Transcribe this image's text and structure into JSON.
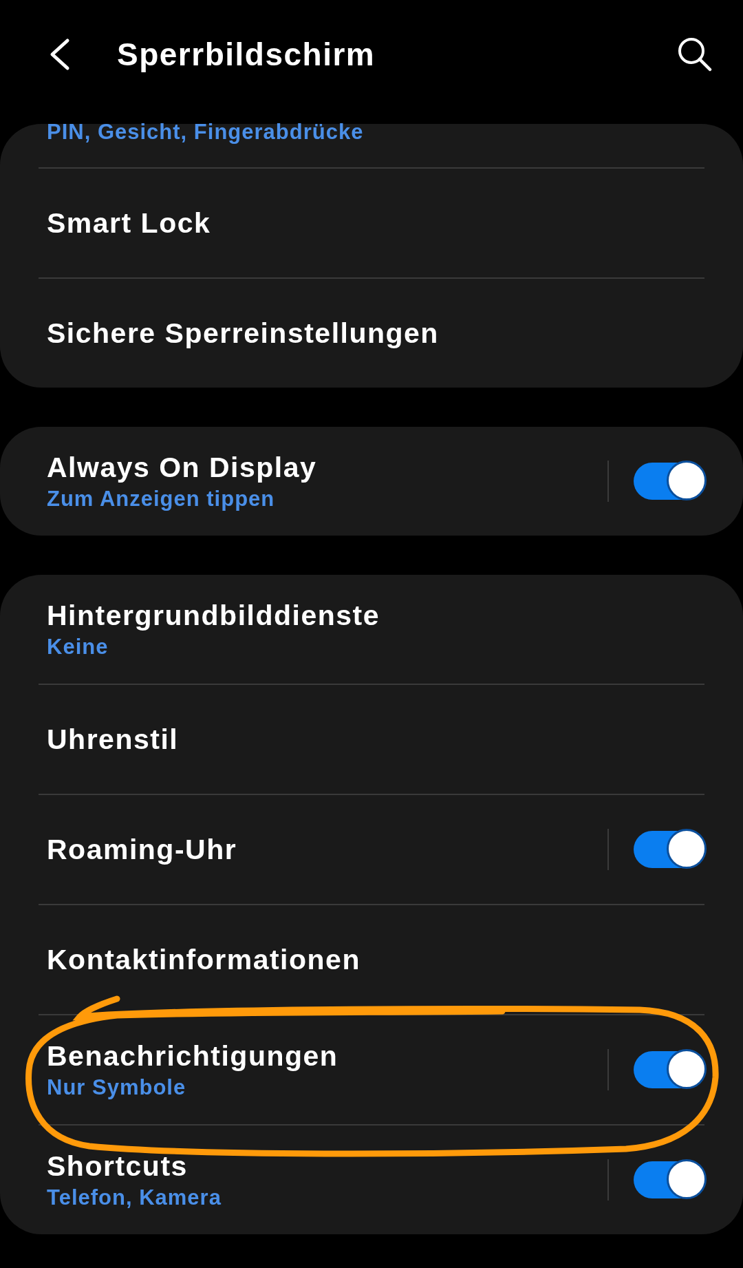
{
  "header": {
    "title": "Sperrbildschirm"
  },
  "groups": [
    {
      "items": [
        {
          "subtitle": "PIN, Gesicht, Fingerabdrücke",
          "kind": "partial"
        },
        {
          "title": "Smart Lock",
          "kind": "link"
        },
        {
          "title": "Sichere Sperreinstellungen",
          "kind": "link"
        }
      ]
    },
    {
      "items": [
        {
          "title": "Always On Display",
          "subtitle": "Zum Anzeigen tippen",
          "kind": "switch",
          "on": true
        }
      ]
    },
    {
      "items": [
        {
          "title": "Hintergrundbilddienste",
          "subtitle": "Keine",
          "kind": "link"
        },
        {
          "title": "Uhrenstil",
          "kind": "link"
        },
        {
          "title": "Roaming-Uhr",
          "kind": "switch",
          "on": true
        },
        {
          "title": "Kontaktinformationen",
          "kind": "link"
        },
        {
          "title": "Benachrichtigungen",
          "subtitle": "Nur Symbole",
          "kind": "switch",
          "on": true,
          "circled": true
        },
        {
          "title": "Shortcuts",
          "subtitle": "Telefon, Kamera",
          "kind": "switch",
          "on": true
        }
      ]
    }
  ]
}
